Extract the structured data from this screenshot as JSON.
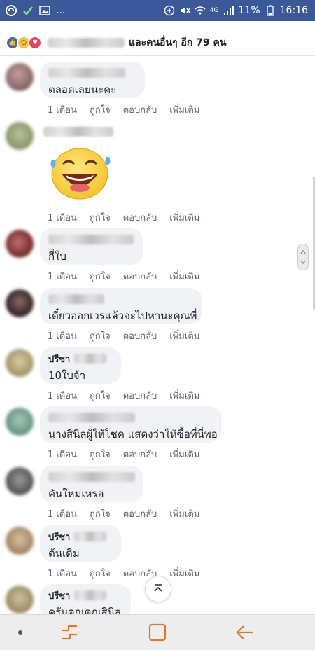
{
  "status_bar": {
    "dots": "...",
    "battery": "11%",
    "time": "16:16",
    "network": "4G"
  },
  "reactions": {
    "icons": [
      "like-icon",
      "wow-icon",
      "love-icon"
    ],
    "text": "และคนอื่นๆ อีก 79 คน"
  },
  "actions": {
    "time": "1 เดือน",
    "like": "ถูกใจ",
    "reply": "ตอบกลับ",
    "more": "เพิ่มเติม"
  },
  "comments": [
    {
      "author": "",
      "text": "ตลอดเลยนะคะ"
    },
    {
      "author": "",
      "text": "",
      "sticker": "laughing-emoji"
    },
    {
      "author": "",
      "text": "กี่ใบ"
    },
    {
      "author": "",
      "text": "เดี๋ยวออกเวรแล้วจะไปหานะคุณพี่"
    },
    {
      "author": "ปรีชา",
      "text": "10ใบจ้า"
    },
    {
      "author": "",
      "text": "นางสินิลผู้ให้โชค แสดงว่าให้ซื้อที่นี่พอ"
    },
    {
      "author": "",
      "text": "คันใหม่เหรอ"
    },
    {
      "author": "ปรีชา",
      "text": "ต้นเดิม"
    },
    {
      "author": "ปรีชา",
      "text": "ครับคุณคุณสินิล"
    }
  ],
  "colors": {
    "status_bar": "#3b5998",
    "bubble": "#f0f2f5",
    "action_text": "#606770"
  }
}
